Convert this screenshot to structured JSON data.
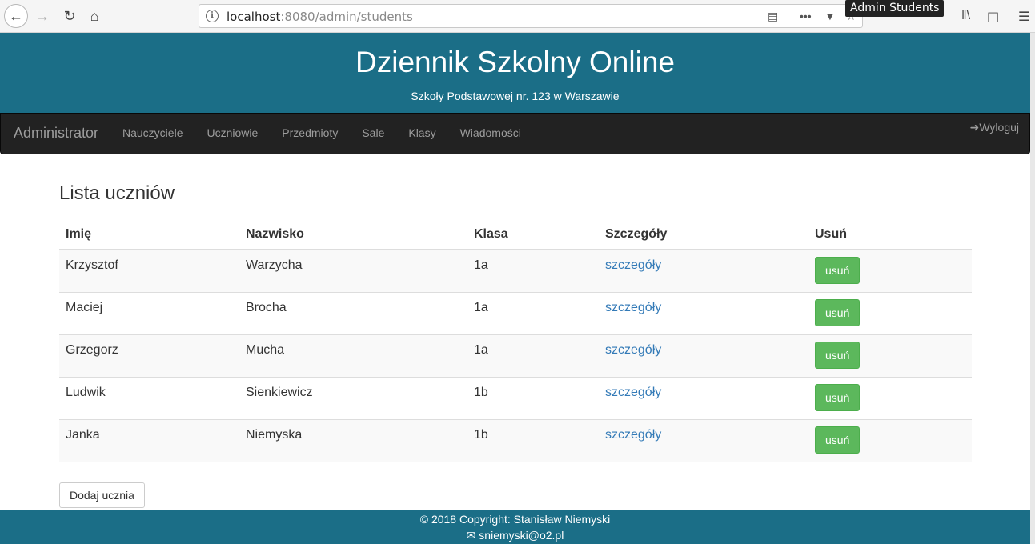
{
  "browser": {
    "url_host": "localhost",
    "url_path": ":8080/admin/students",
    "tooltip": "Admin Students"
  },
  "header": {
    "title": "Dziennik Szkolny Online",
    "subtitle": "Szkoły Podstawowej nr. 123 w Warszawie"
  },
  "navbar": {
    "brand": "Administrator",
    "links": [
      "Nauczyciele",
      "Uczniowie",
      "Przedmioty",
      "Sale",
      "Klasy",
      "Wiadomości"
    ],
    "logout": "Wyloguj"
  },
  "main": {
    "title": "Lista uczniów",
    "columns": [
      "Imię",
      "Nazwisko",
      "Klasa",
      "Szczegóły",
      "Usuń"
    ],
    "rows": [
      {
        "first": "Krzysztof",
        "last": "Warzycha",
        "class": "1a",
        "details": "szczegóły",
        "delete": "usuń"
      },
      {
        "first": "Maciej",
        "last": "Brocha",
        "class": "1a",
        "details": "szczegóły",
        "delete": "usuń"
      },
      {
        "first": "Grzegorz",
        "last": "Mucha",
        "class": "1a",
        "details": "szczegóły",
        "delete": "usuń"
      },
      {
        "first": "Ludwik",
        "last": "Sienkiewicz",
        "class": "1b",
        "details": "szczegóły",
        "delete": "usuń"
      },
      {
        "first": "Janka",
        "last": "Niemyska",
        "class": "1b",
        "details": "szczegóły",
        "delete": "usuń"
      }
    ],
    "add_button": "Dodaj ucznia"
  },
  "footer": {
    "copyright": "© 2018 Copyright: Stanisław Niemyski",
    "email": "sniemyski@o2.pl"
  },
  "colors": {
    "header_bg": "#1b6e87",
    "navbar_bg": "#222222",
    "delete_btn": "#5cb85c",
    "link": "#337ab7"
  }
}
